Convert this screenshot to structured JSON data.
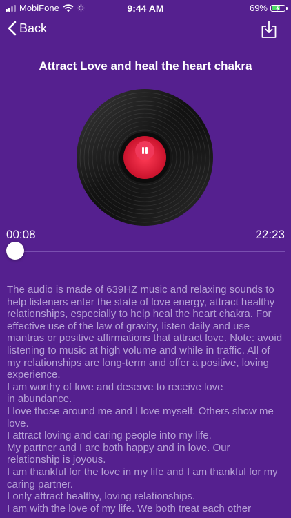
{
  "status_bar": {
    "carrier": "MobiFone",
    "time": "9:44 AM",
    "battery_percent": "69%",
    "battery_level": 0.69,
    "battery_color": "#4cd964"
  },
  "nav": {
    "back_label": "Back",
    "back_icon": "chevron-left-icon",
    "download_icon": "download-icon"
  },
  "player": {
    "title": "Attract Love and heal the heart chakra",
    "state": "playing",
    "play_pause_icon": "pause-icon",
    "current_time": "00:08",
    "total_time": "22:23",
    "progress": 0.006,
    "label_color": "#e8253f"
  },
  "description": {
    "paragraphs": [
      "The audio is made of 639HZ music and relaxing sounds to help listeners enter the state of love energy, attract healthy relationships, especially to help heal the heart chakra. For effective use of the law of gravity, listen daily and use mantras or positive affirmations that attract love. Note: avoid listening to music at high volume and while in traffic. All of my relationships are long-term and offer a positive, loving experience.",
      "I am worthy of love and deserve to receive love\nin abundance.",
      "I love those around me and I love myself. Others show me love.",
      "I attract loving and caring people into my life.",
      "My partner and I are both happy and in love. Our relationship is joyous.",
      "I am thankful for the love in my life and I am thankful for my caring partner.",
      "I only attract healthy, loving relationships.",
      "I am with the love of my life. We both treat each other"
    ]
  },
  "theme": {
    "background": "#55208f",
    "description_text": "#b6a3d6"
  }
}
